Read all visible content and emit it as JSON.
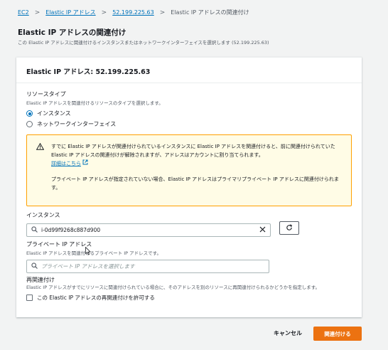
{
  "breadcrumb": {
    "items": [
      "EC2",
      "Elastic IP アドレス",
      "52.199.225.63"
    ],
    "current": "Elastic IP アドレスの関連付け"
  },
  "page": {
    "title": "Elastic IP アドレスの関連付け",
    "description": "この Elastic IP アドレスに関連付けるインスタンスまたはネットワークインターフェイスを選択します (52.199.225.63)"
  },
  "panel": {
    "header": "Elastic IP アドレス: 52.199.225.63"
  },
  "resource_type": {
    "label": "リソースタイプ",
    "description": "Elastic IP アドレスを関連付けるリソースのタイプを選択します。",
    "options": [
      "インスタンス",
      "ネットワークインターフェイス"
    ],
    "selected": "インスタンス"
  },
  "warning": {
    "text1": "すでに Elastic IP アドレスが関連付けられているインスタンスに Elastic IP アドレスを関連付けると、前に関連付けられていた Elastic IP アドレスの関連付けが解除されますが、アドレスはアカウントに割り当てられます。",
    "link": "詳細はこちら",
    "text2": "プライベート IP アドレスが指定されていない場合、Elastic IP アドレスはプライマリプライベート IP アドレスに関連付けられます。"
  },
  "instance": {
    "label": "インスタンス",
    "value": "i-0d99f9268c887d900"
  },
  "private_ip": {
    "label": "プライベート IP アドレス",
    "description": "Elastic IP アドレスを関連付けるプライベート IP アドレスです。",
    "placeholder": "プライベート IP アドレスを選択します"
  },
  "reassociation": {
    "label": "再関連付け",
    "description": "Elastic IP アドレスがすでにリソースに関連付けられている場合に、そのアドレスを別のリソースに再関連付けられるかどうかを指定します。",
    "checkbox_label": "この Elastic IP アドレスの再関連付けを許可する"
  },
  "actions": {
    "cancel": "キャンセル",
    "submit": "関連付ける"
  },
  "colors": {
    "primary": "#ec7211",
    "link": "#0073bb",
    "warning_border": "#ffa000",
    "warning_bg": "#fffce6"
  },
  "icons": [
    "external-link-icon",
    "warning-icon",
    "search-icon",
    "clear-icon",
    "refresh-icon",
    "chevron-right-icon"
  ]
}
